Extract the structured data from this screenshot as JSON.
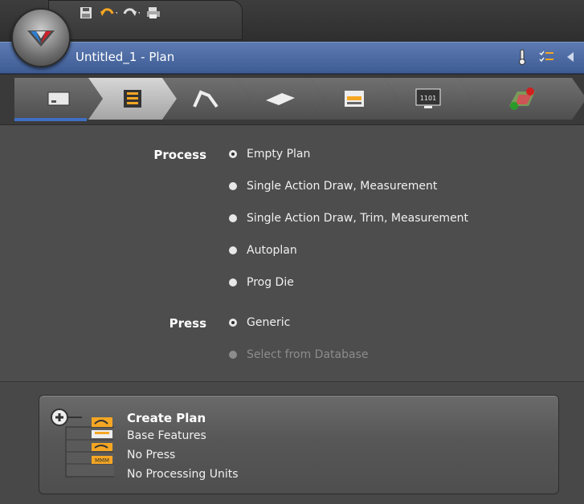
{
  "window": {
    "title": "Untitled_1 - Plan"
  },
  "quick_access": [
    "save-icon",
    "undo-icon",
    "redo-icon",
    "print-icon"
  ],
  "title_icons": [
    "thermometer-icon",
    "checklist-icon",
    "collapse-arrow-icon"
  ],
  "steps": [
    {
      "id": "step-plan",
      "icon": "plan-icon",
      "active": false
    },
    {
      "id": "step-setup",
      "icon": "process-icon",
      "active": true
    },
    {
      "id": "step-draw",
      "icon": "draw-die-icon",
      "active": false
    },
    {
      "id": "step-blank",
      "icon": "blank-icon",
      "active": false
    },
    {
      "id": "step-press",
      "icon": "press-icon",
      "active": false
    },
    {
      "id": "step-simulation",
      "icon": "monitor-icon",
      "active": false
    },
    {
      "id": "step-results",
      "icon": "results-icon",
      "active": false
    }
  ],
  "step_monitor_text": "1101",
  "process": {
    "label": "Process",
    "options": [
      {
        "label": "Empty Plan",
        "selected": true
      },
      {
        "label": "Single Action Draw, Measurement",
        "selected": false
      },
      {
        "label": "Single Action Draw, Trim, Measurement",
        "selected": false
      },
      {
        "label": "Autoplan",
        "selected": false
      },
      {
        "label": "Prog Die",
        "selected": false
      }
    ]
  },
  "press": {
    "label": "Press",
    "options": [
      {
        "label": "Generic",
        "selected": true,
        "enabled": true
      },
      {
        "label": "Select from Database",
        "selected": false,
        "enabled": false
      }
    ]
  },
  "create_plan": {
    "title": "Create Plan",
    "lines": [
      "Base Features",
      "No Press",
      "No Processing Units"
    ],
    "icon": "create-plan-icon"
  },
  "colors": {
    "title_bar": "#4a6aa5",
    "active_step_underline": "#3f6fc4",
    "panel_bg": "#4d4d4d"
  }
}
